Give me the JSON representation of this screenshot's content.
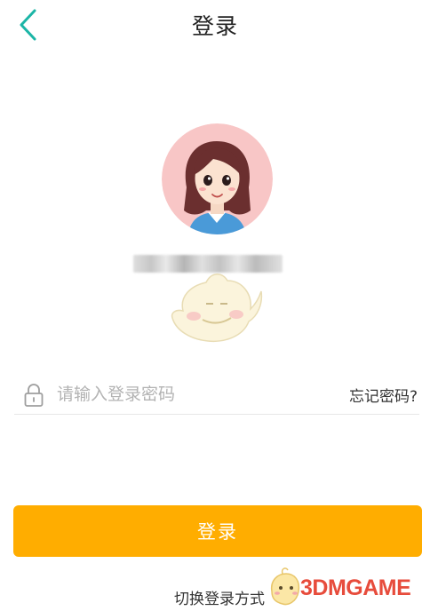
{
  "header": {
    "title": "登录",
    "back_icon": "chevron-left-icon",
    "accent_color": "#1bb5a6"
  },
  "account": {
    "avatar": "female-avatar-illustration",
    "masked_account_text": ""
  },
  "password_field": {
    "icon": "lock-icon",
    "placeholder": "请输入登录密码",
    "value": "",
    "forgot_label": "忘记密码?"
  },
  "login_button": {
    "label": "登录",
    "color": "#ffad00"
  },
  "footer": {
    "switch_label": "切换登录方式"
  },
  "watermark": {
    "text": "3DMGAME"
  }
}
